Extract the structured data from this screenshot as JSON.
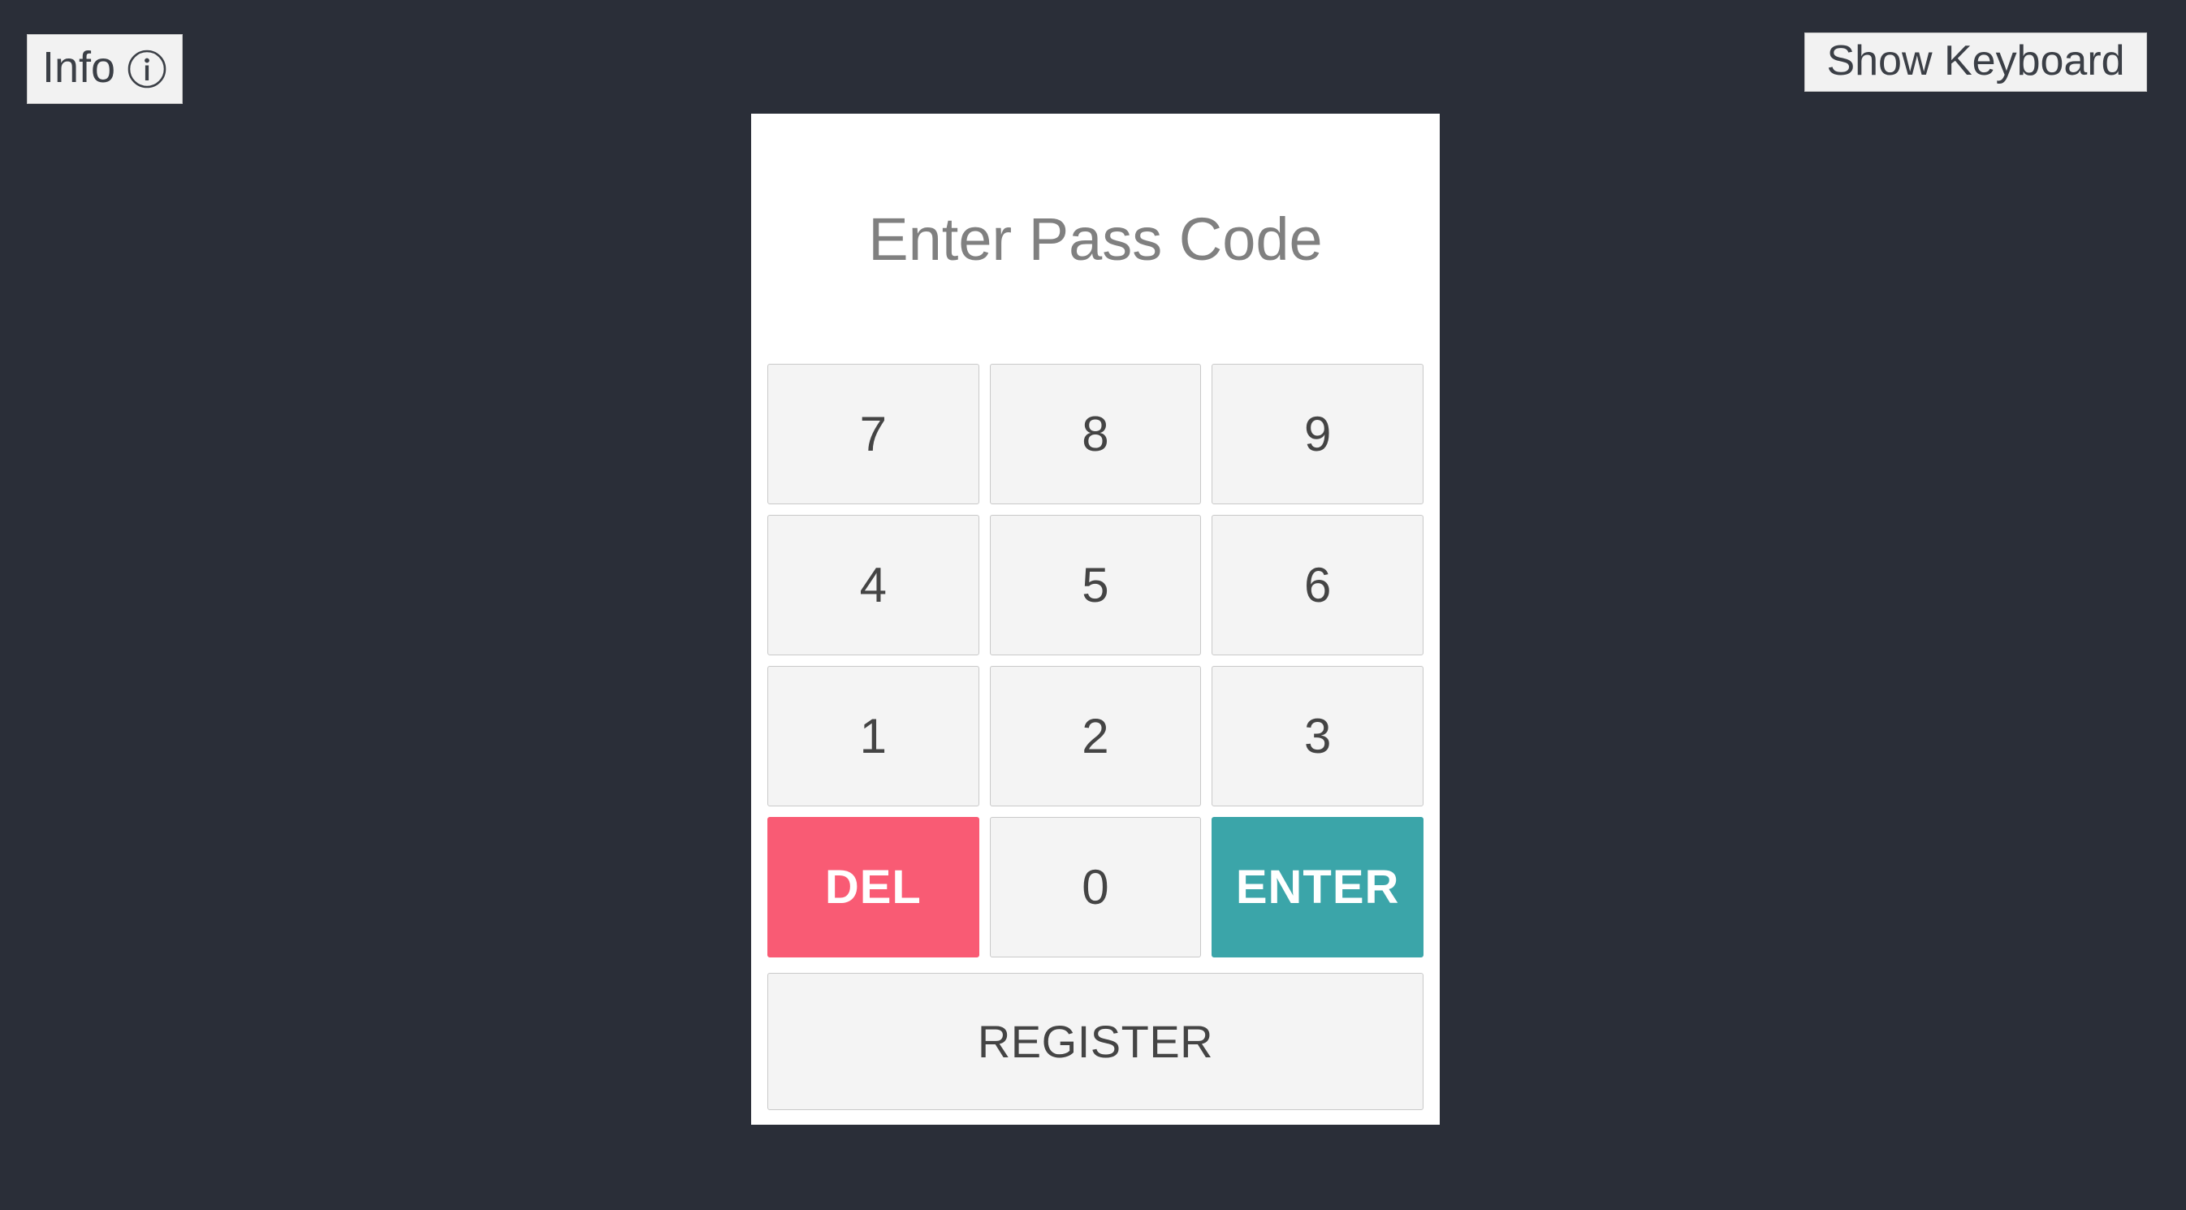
{
  "background_color": "#2a2e38",
  "toolbar": {
    "info_button": {
      "label": "Info",
      "icon": "info-circle-icon"
    },
    "show_keyboard_button": {
      "label": "Show Keyboard"
    }
  },
  "card": {
    "title": "Enter Pass Code",
    "background_color": "#ffffff",
    "title_color": "#808080",
    "keypad": {
      "keys": [
        {
          "label": "7",
          "kind": "digit",
          "name": "key-7"
        },
        {
          "label": "8",
          "kind": "digit",
          "name": "key-8"
        },
        {
          "label": "9",
          "kind": "digit",
          "name": "key-9"
        },
        {
          "label": "4",
          "kind": "digit",
          "name": "key-4"
        },
        {
          "label": "5",
          "kind": "digit",
          "name": "key-5"
        },
        {
          "label": "6",
          "kind": "digit",
          "name": "key-6"
        },
        {
          "label": "1",
          "kind": "digit",
          "name": "key-1"
        },
        {
          "label": "2",
          "kind": "digit",
          "name": "key-2"
        },
        {
          "label": "3",
          "kind": "digit",
          "name": "key-3"
        },
        {
          "label": "DEL",
          "kind": "del",
          "name": "key-delete"
        },
        {
          "label": "0",
          "kind": "digit",
          "name": "key-0"
        },
        {
          "label": "ENTER",
          "kind": "enter",
          "name": "key-enter"
        }
      ],
      "del_color": "#f95b74",
      "enter_color": "#3ba5a9",
      "digit_color": "#f4f4f4"
    },
    "register_button": {
      "label": "REGISTER"
    }
  }
}
